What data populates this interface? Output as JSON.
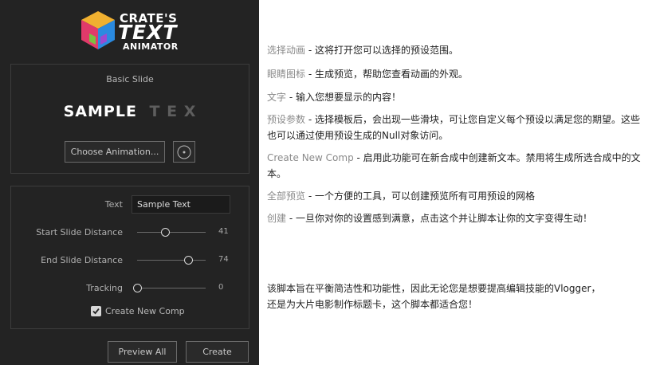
{
  "logo": {
    "line1": "CRATE'S",
    "line2": "TEXT",
    "line3": "ANIMATOR"
  },
  "preview": {
    "slide_name": "Basic Slide",
    "sample_main": "SAMPLE",
    "sample_fade": "T E X",
    "choose_label": "Choose Animation...",
    "eye_icon": "eye-icon"
  },
  "settings": {
    "text_label": "Text",
    "text_value": "Sample Text",
    "sliders": [
      {
        "label": "Start Slide Distance",
        "value": "41",
        "fraction": 0.41
      },
      {
        "label": "End Slide Distance",
        "value": "74",
        "fraction": 0.74
      },
      {
        "label": "Tracking",
        "value": "0",
        "fraction": 0.0
      }
    ],
    "checkbox_label": "Create New Comp",
    "checkbox_checked": true
  },
  "actions": {
    "preview_all": "Preview All",
    "create": "Create"
  },
  "descriptions": [
    {
      "term": "选择动画",
      "text": " - 这将打开您可以选择的预设范围。"
    },
    {
      "term": "眼睛图标",
      "text": " - 生成预览，帮助您查看动画的外观。"
    },
    {
      "term": "文字",
      "text": " - 输入您想要显示的内容！"
    },
    {
      "term": "预设参数",
      "text": " - 选择模板后，会出现一些滑块，可让您自定义每个预设以满足您的期望。这些也可以通过使用预设生成的Null对象访问。"
    },
    {
      "term": "Create New Comp",
      "text": " - 启用此功能可在新合成中创建新文本。禁用将生成所选合成中的文本。"
    },
    {
      "term": "全部预览",
      "text": " - 一个方便的工具，可以创建预览所有可用预设的网格"
    },
    {
      "term": "创建",
      "text": " - 一旦你对你的设置感到满意，点击这个并让脚本让你的文字变得生动！"
    }
  ],
  "footer_text": "该脚本旨在平衡简洁性和功能性，因此无论您是想要提高编辑技能的Vlogger，还是为大片电影制作标题卡，这个脚本都适合您！"
}
